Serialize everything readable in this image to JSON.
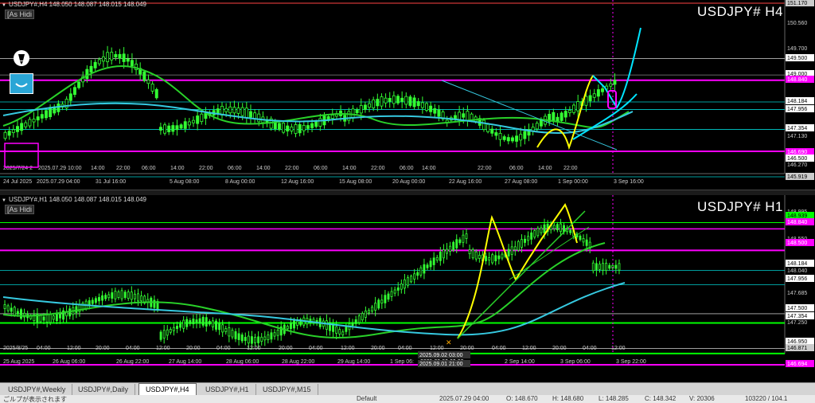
{
  "pane1": {
    "header": "USDJPY#,H4  148.050 148.087 148.015 148.049",
    "ashidi": "[As Hidi",
    "symbol": "USDJPY# H4",
    "price_labels": [
      {
        "text": "151.170",
        "color": "#000",
        "bg": "#ccc"
      },
      {
        "text": "150.560",
        "color": "#ccc",
        "bg": "#000"
      },
      {
        "text": "149.700",
        "color": "#ccc",
        "bg": "#000"
      },
      {
        "text": "149.500",
        "color": "#000",
        "bg": "#fff"
      },
      {
        "text": "149.000",
        "color": "#000",
        "bg": "#fff"
      },
      {
        "text": "148.840",
        "color": "#fff",
        "bg": "#ff00ff"
      },
      {
        "text": "148.184",
        "color": "#000",
        "bg": "#fff"
      },
      {
        "text": "147.956",
        "color": "#000",
        "bg": "#fff"
      },
      {
        "text": "147.354",
        "color": "#000",
        "bg": "#fff"
      },
      {
        "text": "147.130",
        "color": "#ccc",
        "bg": "#000"
      },
      {
        "text": "146.690",
        "color": "#fff",
        "bg": "#ff00ff"
      },
      {
        "text": "146.500",
        "color": "#000",
        "bg": "#fff"
      },
      {
        "text": "146.270",
        "color": "#ccc",
        "bg": "#000"
      },
      {
        "text": "145.919",
        "color": "#000",
        "bg": "#ccc"
      }
    ],
    "upper_time_labels": [
      "2025/7/24 2",
      "2025.07.29 10:00",
      "14:00",
      "22:00",
      "06:00",
      "14:00",
      "22:00",
      "06:00",
      "14:00",
      "22:00",
      "06:00",
      "14:00",
      "22:00",
      "06:00",
      "14:00",
      "22:00",
      "06:00",
      "14:00",
      "22:00"
    ],
    "date_labels": [
      "24 Jul 2025",
      "2025.07.29 04:00",
      "31 Jul 16:00",
      "5 Aug 08:00",
      "8 Aug 00:00",
      "12 Aug 16:00",
      "15 Aug 08:00",
      "20 Aug 00:00",
      "22 Aug 16:00",
      "27 Aug 08:00",
      "1 Sep 00:00",
      "3 Sep 16:00"
    ]
  },
  "pane2": {
    "header": "USDJPY#,H1  148.050 148.087 148.015 148.049",
    "ashidi": "[As Hidi",
    "symbol": "USDJPY# H1",
    "price_labels": [
      {
        "text": "148.995",
        "color": "#ccc",
        "bg": "#000"
      },
      {
        "text": "148.939",
        "color": "#000",
        "bg": "#00ff00"
      },
      {
        "text": "148.840",
        "color": "#fff",
        "bg": "#ff00ff"
      },
      {
        "text": "148.550",
        "color": "#ccc",
        "bg": "#000"
      },
      {
        "text": "148.500",
        "color": "#fff",
        "bg": "#ff00ff"
      },
      {
        "text": "148.184",
        "color": "#000",
        "bg": "#fff"
      },
      {
        "text": "148.040",
        "color": "#ccc",
        "bg": "#000"
      },
      {
        "text": "147.956",
        "color": "#000",
        "bg": "#fff"
      },
      {
        "text": "147.685",
        "color": "#ccc",
        "bg": "#000"
      },
      {
        "text": "147.500",
        "color": "#000",
        "bg": "#fff"
      },
      {
        "text": "147.354",
        "color": "#000",
        "bg": "#fff"
      },
      {
        "text": "147.250",
        "color": "#ccc",
        "bg": "#000"
      },
      {
        "text": "146.950",
        "color": "#000",
        "bg": "#fff"
      },
      {
        "text": "146.871",
        "color": "#000",
        "bg": "#ccc"
      },
      {
        "text": "146.694",
        "color": "#fff",
        "bg": "#ff00ff"
      }
    ],
    "upper_time_labels": [
      "2025/8/25",
      "04:00",
      "12:00",
      "20:00",
      "04:00",
      "12:00",
      "20:00",
      "04:00",
      "12:00",
      "20:00",
      "04:00",
      "12:00",
      "20:00",
      "04:00",
      "12:00",
      "20:00",
      "04:00",
      "12:00",
      "20:00",
      "04:00",
      "12:00",
      "20:00",
      "04:00"
    ],
    "date_labels": [
      "25 Aug 2025",
      "26 Aug 06:00",
      "26 Aug 22:00",
      "27 Aug 14:00",
      "28 Aug 06:00",
      "28 Aug 22:00",
      "29 Aug 14:00",
      "1 Sep 06:",
      "2025.09.01 21:00",
      "2025.09.02 03:00",
      "2 Sep 14:00",
      "3 Sep 06:00",
      "3 Sep 22:00"
    ]
  },
  "tabs": [
    "USDJPY#,Weekly",
    "USDJPY#,Daily",
    "USDJPY#,H4",
    "USDJPY#,H1",
    "USDJPY#,M15"
  ],
  "active_tab": "USDJPY#,H4",
  "status": [
    "ごルプが表示されます",
    "Default",
    "2025.07.29 04:00",
    "O: 148.670",
    "H: 148.680",
    "L: 148.285",
    "C: 148.342",
    "V: 20306",
    "103220 / 104.1"
  ],
  "icons": [
    "pen-tool-icon",
    "smile-face-icon"
  ],
  "colors": {
    "magenta": "#ff00ff",
    "cyan": "#00e5ff",
    "lime": "#00ff00",
    "yellow": "#ffff00",
    "candle": "#33ff33",
    "ma_fast": "#29d129",
    "ma_slow": "#36c9e0",
    "trend": "#36c9e0"
  }
}
